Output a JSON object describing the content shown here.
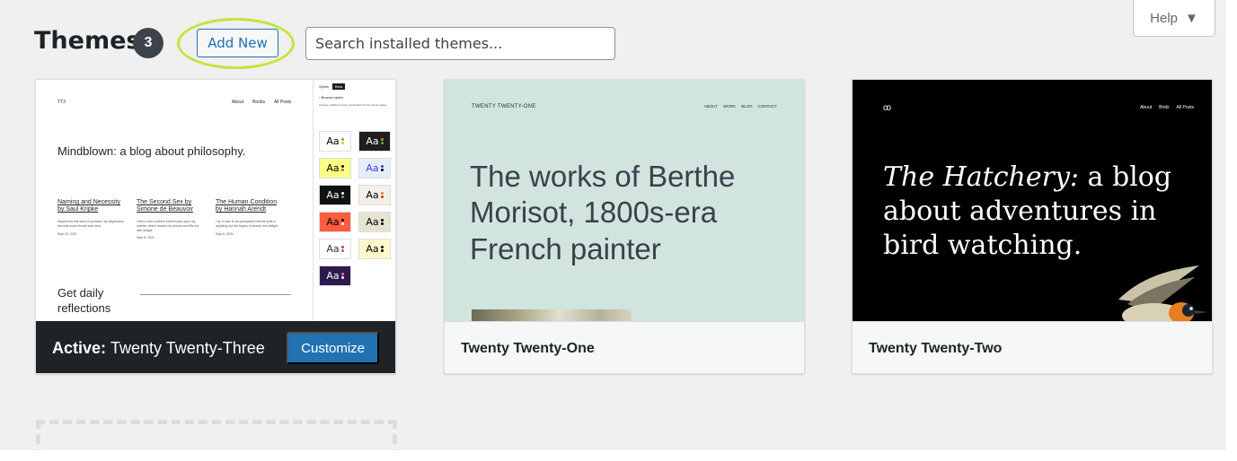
{
  "header": {
    "title": "Themes",
    "count": "3",
    "add_new_label": "Add New",
    "search_placeholder": "Search installed themes...",
    "help_label": "Help"
  },
  "themes": [
    {
      "name": "Twenty Twenty-Three",
      "active": true,
      "active_label": "Active:",
      "customize_label": "Customize",
      "preview": {
        "site_logo": "TT3",
        "nav": [
          "About",
          "Books",
          "All Posts"
        ],
        "headline": "Mindblown: a blog about philosophy.",
        "posts": [
          {
            "title": "Naming and Necessity by Saul Kripke",
            "excerpt": "Inspired by this wind of promise, my daydreams become more fervent and vivid.",
            "date": "Sept 10, 2021"
          },
          {
            "title": "The Second Sex by Simone de Beauvoir",
            "excerpt": "I feel a cold northern breeze play upon my cheeks, which braces my nerves and fills me with delight.",
            "date": "Sept 8, 2021"
          },
          {
            "title": "The Human Condition by Hannah Arendt",
            "excerpt": "I try in vain to be persuaded that the pole is anything but the region of beauty and delight.",
            "date": "Sept 6, 2021"
          }
        ],
        "footer_text": "Get daily reflections",
        "styles_panel": {
          "title": "Styles",
          "badge": "Beta",
          "browse": "Browse styles",
          "note": "Choose a different style combination for the theme styles",
          "swatch_label": "Aa",
          "swatches": [
            {
              "bg": "#ffffff",
              "fg": "#000000",
              "dots": [
                "#2ecc40",
                "#f1c40f"
              ]
            },
            {
              "bg": "#1e1e1e",
              "fg": "#ffffff",
              "dots": [
                "#e67e22",
                "#2ecc40"
              ]
            },
            {
              "bg": "#faff85",
              "fg": "#000000",
              "dots": [
                "#000000",
                "#e74c3c"
              ]
            },
            {
              "bg": "#e8ecff",
              "fg": "#3c3cf0",
              "dots": [
                "#3c3cf0",
                "#000000"
              ]
            },
            {
              "bg": "#111111",
              "fg": "#ffffff",
              "dots": [
                "#ffffff",
                "#2ecc40"
              ]
            },
            {
              "bg": "#f4efe8",
              "fg": "#000000",
              "dots": [
                "#e67e22",
                "#c0392b"
              ]
            },
            {
              "bg": "#ff5c40",
              "fg": "#000000",
              "dots": [
                "#000000",
                "#ffffff"
              ]
            },
            {
              "bg": "#e6e3cf",
              "fg": "#000000",
              "dots": [
                "#000000",
                "#000000"
              ]
            },
            {
              "bg": "#ffffff",
              "fg": "#333333",
              "dots": [
                "#8e44ad",
                "#e74c3c"
              ]
            },
            {
              "bg": "#fff8cc",
              "fg": "#000000",
              "dots": [
                "#000000",
                "#000000"
              ]
            },
            {
              "bg": "#2d1b4e",
              "fg": "#ffffff",
              "dots": [
                "#ff6b9b",
                "#ffffff"
              ]
            }
          ]
        }
      }
    },
    {
      "name": "Twenty Twenty-One",
      "active": false,
      "preview": {
        "brand": "TWENTY TWENTY-ONE",
        "nav": [
          "ABOUT",
          "WORK",
          "BLOG",
          "CONTACT"
        ],
        "headline": "The works of Berthe Morisot, 1800s-era French painter"
      }
    },
    {
      "name": "Twenty Twenty-Two",
      "active": false,
      "preview": {
        "logo": "oo",
        "nav": [
          "About",
          "Birds",
          "All Posts"
        ],
        "headline_italic": "The Hatchery:",
        "headline_rest": " a blog about adventures in bird watching."
      }
    }
  ],
  "colors": {
    "accent": "#2271b1",
    "highlight": "#c9e33a",
    "active_footer": "#1d2327"
  }
}
